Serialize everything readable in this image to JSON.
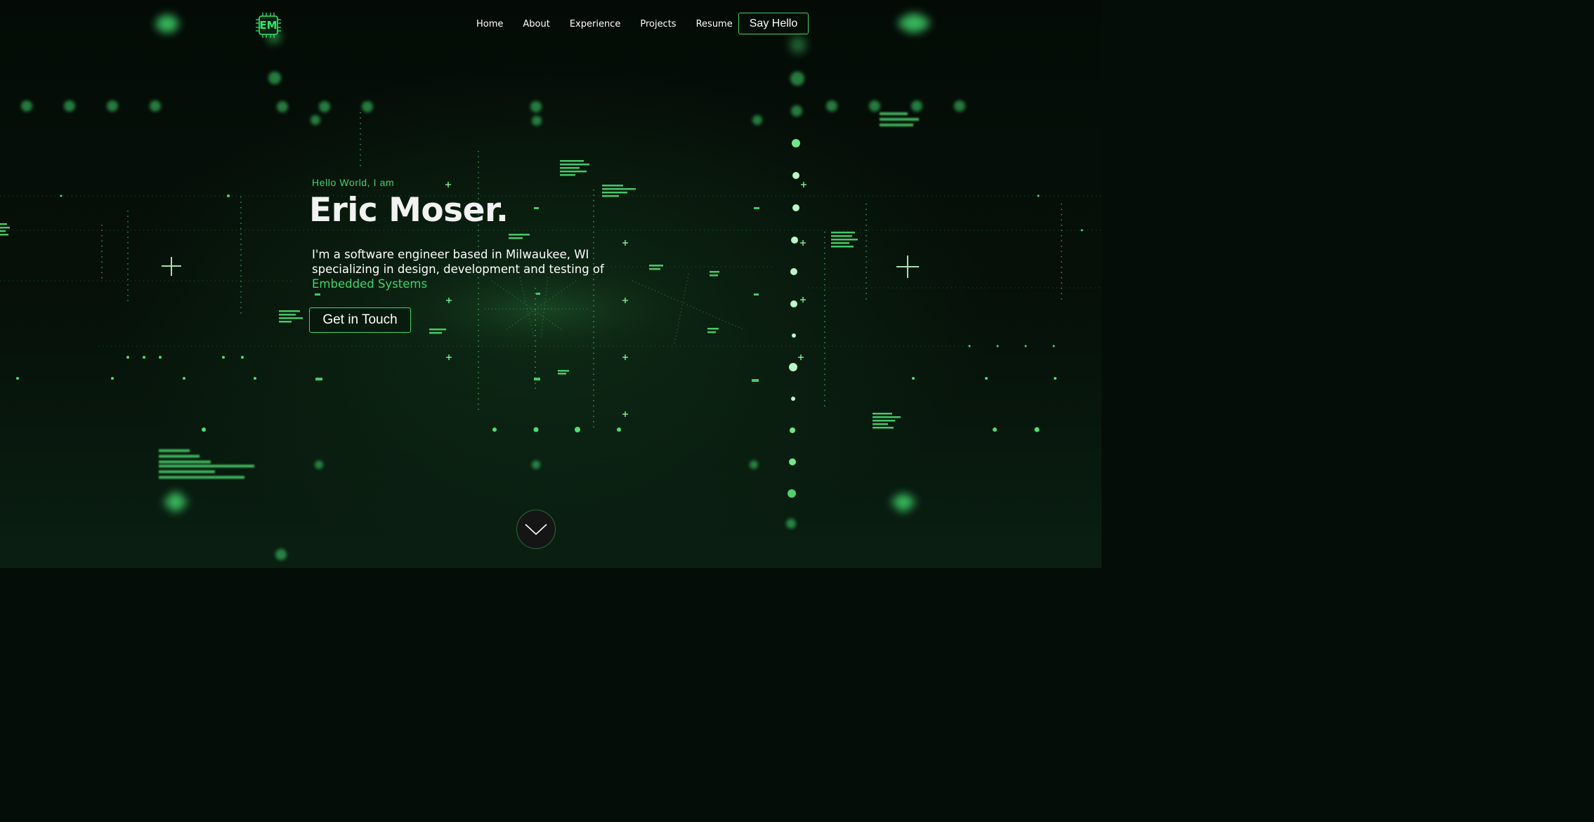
{
  "header": {
    "logo_text": "EM",
    "nav": [
      "Home",
      "About",
      "Experience",
      "Projects",
      "Resume"
    ],
    "cta_label": "Say Hello"
  },
  "hero": {
    "greeting": "Hello World, I am",
    "name": "Eric Moser.",
    "description": "I'm a software engineer based in Milwaukee, WI specializing in design, development and testing of",
    "highlight": "Embedded Systems",
    "button_label": "Get in Touch"
  },
  "icons": {
    "logo": "chip-icon",
    "scroll": "chevron-down-icon"
  },
  "colors": {
    "accent": "#3fd46b",
    "background": "#050d08",
    "text": "#ffffff",
    "scroll_button": "#151515"
  }
}
